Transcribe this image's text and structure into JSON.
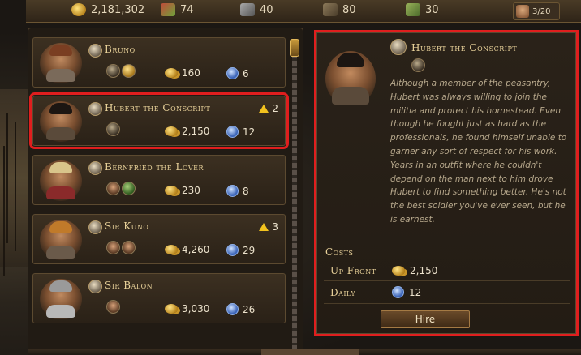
{
  "resources": {
    "gold": "2,181,302",
    "food": "74",
    "tools": "40",
    "men": "80",
    "herbs": "30",
    "party": "3/20"
  },
  "mercenaries": [
    {
      "name": "Bruno",
      "gold": "160",
      "moon": "6",
      "level_up": "",
      "trait_icons": [
        "moon-trait-icon",
        "gold-trait-icon"
      ],
      "hair": "#7a3e22",
      "armor": "#7a6a5a"
    },
    {
      "name": "Hubert the Conscript",
      "gold": "2,150",
      "moon": "12",
      "level_up": "2",
      "trait_icons": [
        "trait-icon"
      ],
      "hair": "#1c1612",
      "armor": "#5a4a3a"
    },
    {
      "name": "Bernfried the Lover",
      "gold": "230",
      "moon": "8",
      "level_up": "",
      "trait_icons": [
        "face-trait-icon",
        "green-trait-icon"
      ],
      "hair": "#d8c48a",
      "armor": "#8a2a2a"
    },
    {
      "name": "Sir Kuno",
      "gold": "4,260",
      "moon": "29",
      "level_up": "3",
      "trait_icons": [
        "face-trait-icon",
        "face-trait-icon"
      ],
      "hair": "#c07a2a",
      "armor": "#6a5a4a"
    },
    {
      "name": "Sir Balon",
      "gold": "3,030",
      "moon": "26",
      "level_up": "",
      "trait_icons": [
        "face-trait-icon"
      ],
      "hair": "#9a9a9a",
      "armor": "#b8b8b8"
    }
  ],
  "detail": {
    "name": "Hubert the Conscript",
    "description": "Although a member of the peasantry, Hubert was always willing to join the militia and protect his homestead. Even though he fought just as hard as the professionals, he found himself unable to garner any sort of respect for his work. Years in an outfit where he couldn't depend on the man next to him drove Hubert to find something better. He's not the best soldier you've ever seen, but he is earnest.",
    "costs_label": "Costs",
    "up_front_label": "Up Front",
    "up_front_value": "2,150",
    "daily_label": "Daily",
    "daily_value": "12",
    "hire_label": "Hire"
  },
  "colors": {
    "highlight": "#e01e1e",
    "name_text": "#e9d29a",
    "level_arrow": "#f2c21e"
  }
}
